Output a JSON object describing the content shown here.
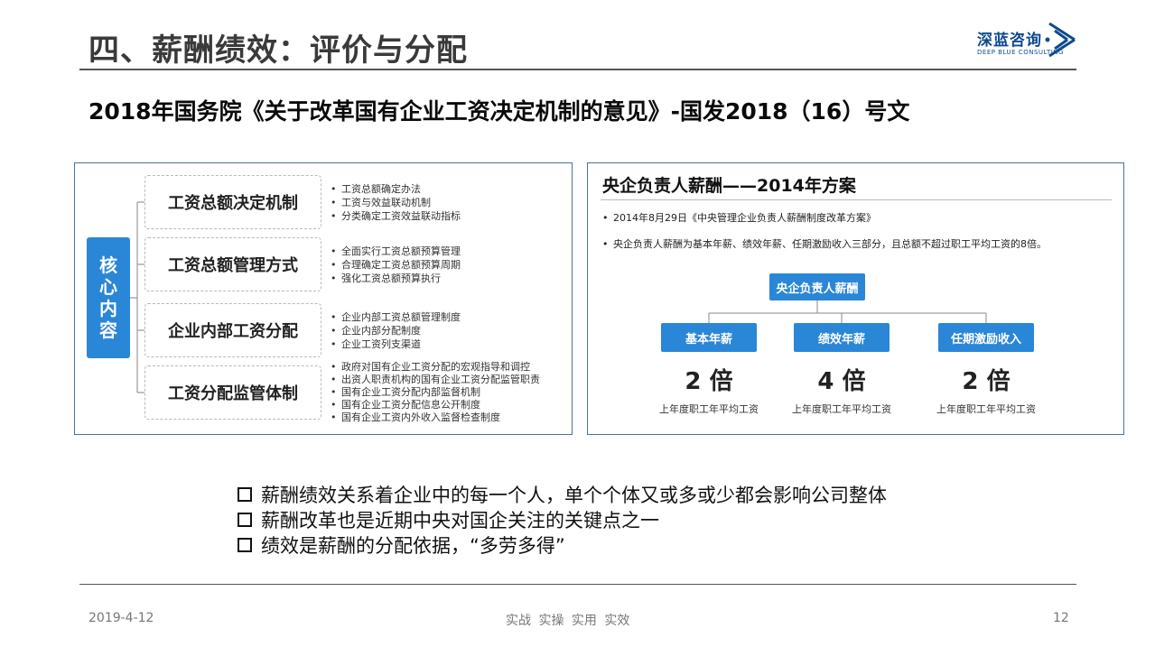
{
  "header": {
    "title": "四、薪酬绩效：评价与分配",
    "subtitle": "2018年国务院《关于改革国有企业工资决定机制的意见》-国发2018（16）号文",
    "logo": {
      "cn": "深蓝咨询",
      "en": "DEEP BLUE CONSULTING",
      "icon": "deep-blue-logo-mark",
      "color": "#0e4a8f"
    }
  },
  "left_panel": {
    "core_label": [
      "核",
      "心",
      "内",
      "容"
    ],
    "mechanisms": [
      {
        "title": "工资总额决定机制",
        "items": [
          "工资总额确定办法",
          "工资与效益联动机制",
          "分类确定工资效益联动指标"
        ]
      },
      {
        "title": "工资总额管理方式",
        "items": [
          "全面实行工资总额预算管理",
          "合理确定工资总额预算周期",
          "强化工资总额预算执行"
        ]
      },
      {
        "title": "企业内部工资分配",
        "items": [
          "企业内部工资总额管理制度",
          "企业内部分配制度",
          "企业工资列支渠道"
        ]
      },
      {
        "title": "工资分配监管体制",
        "items": [
          "政府对国有企业工资分配的宏观指导和调控",
          "出资人职责机构的国有企业工资分配监管职责",
          "国有企业工资分配内部监督机制",
          "国有企业工资分配信息公开制度",
          "国有企业工资内外收入监督检查制度"
        ]
      }
    ]
  },
  "right_panel": {
    "title": "央企负责人薪酬——2014年方案",
    "bullets": [
      "2014年8月29日《中央管理企业负责人薪酬制度改革方案》",
      "央企负责人薪酬为基本年薪、绩效年薪、任期激励收入三部分，且总额不超过职工平均工资的8倍。"
    ],
    "root": "央企负责人薪酬",
    "nodes": [
      {
        "label": "基本年薪",
        "multiple": "2 倍",
        "caption": "上年度职工年平均工资"
      },
      {
        "label": "绩效年薪",
        "multiple": "4 倍",
        "caption": "上年度职工年平均工资"
      },
      {
        "label": "任期激励收入",
        "multiple": "2 倍",
        "caption": "上年度职工年平均工资"
      }
    ],
    "accent": "#2a86d6"
  },
  "points": [
    "薪酬绩效关系着企业中的每一个人，单个个体又或多或少都会影响公司整体",
    "薪酬改革也是近期中央对国企关注的关键点之一",
    "绩效是薪酬的分配依据，“多劳多得”"
  ],
  "footer": {
    "date": "2019-4-12",
    "slogan": "实战  实操  实用  实效",
    "page": "12"
  }
}
